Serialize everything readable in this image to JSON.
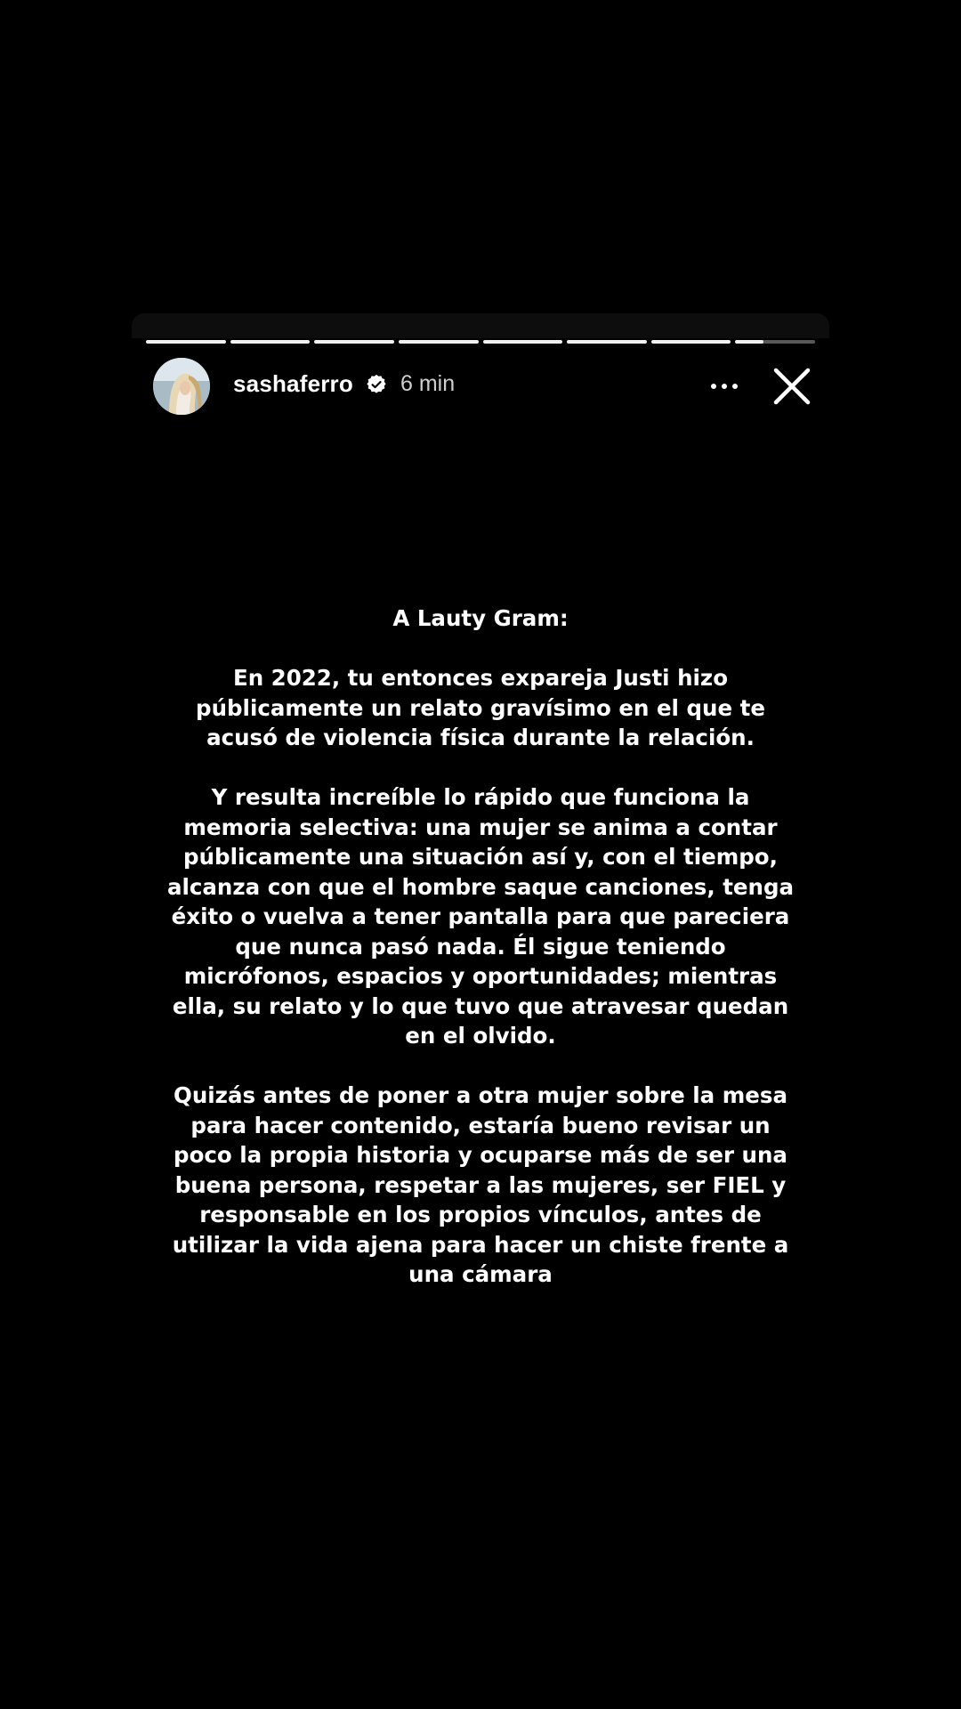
{
  "story": {
    "progress": {
      "segments_total": 8,
      "segments_complete": 7,
      "current_segment_progress": 0.35
    },
    "header": {
      "username": "sashaferro",
      "verified": true,
      "time_ago": "6 min",
      "avatar_icon": "user-avatar",
      "verified_icon": "verified-badge-icon",
      "more_icon": "ellipsis-icon",
      "close_icon": "close-icon"
    },
    "text": {
      "heading": "A Lauty Gram:",
      "paragraph_1": "En 2022, tu entonces expareja Justi  hizo públicamente un relato gravísimo en el que te acusó de violencia física durante la relación.",
      "paragraph_2": "Y resulta increíble lo rápido que funciona la memoria selectiva: una mujer se anima a contar públicamente una situación así y, con el tiempo, alcanza con que el hombre saque canciones, tenga éxito o vuelva a tener pantalla para que pareciera que nunca pasó nada. Él sigue teniendo micrófonos, espacios y oportunidades; mientras ella, su relato y lo que tuvo que atravesar quedan en el olvido.",
      "paragraph_3": "Quizás antes de poner a otra mujer sobre la mesa para hacer contenido, estaría bueno revisar un poco la propia historia y ocuparse más de ser una buena persona, respetar a las mujeres, ser FIEL y responsable en los propios vínculos, antes de utilizar la vida ajena para hacer un chiste frente a una cámara"
    }
  },
  "colors": {
    "background": "#000000",
    "text": "#ffffff",
    "secondary_text": "#cfcfcf"
  }
}
